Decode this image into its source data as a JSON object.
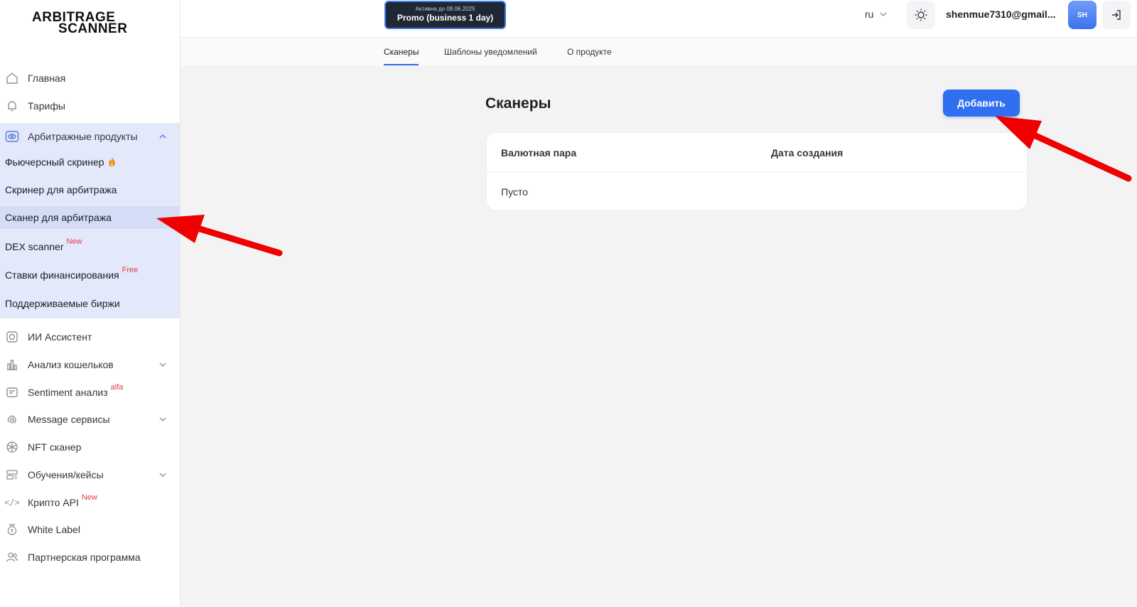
{
  "logo": {
    "line1": "ARBITRAGE",
    "line2": "SCANNER"
  },
  "header": {
    "promo_small": "Активна до 08.06.2025",
    "promo_big": "Promo (business 1 day)",
    "lang": "ru",
    "email": "shenmue7310@gmail...",
    "avatar": "SH"
  },
  "tabs": [
    "Сканеры",
    "Шаблоны уведомлений",
    "О продукте"
  ],
  "sidebar": {
    "items": [
      {
        "label": "Главная",
        "icon": "home-icon"
      },
      {
        "label": "Тарифы",
        "icon": "bell-icon"
      },
      {
        "label": "Арбитражные продукты",
        "icon": "eye-icon"
      },
      {
        "label": "ИИ Ассистент",
        "icon": "robot-icon"
      },
      {
        "label": "Анализ кошельков",
        "icon": "bar-chart-icon"
      },
      {
        "label": "Sentiment анализ",
        "tag": "alfa",
        "icon": "sentiment-icon"
      },
      {
        "label": "Message сервисы",
        "icon": "fingerprint-icon"
      },
      {
        "label": "NFT сканер",
        "icon": "nft-icon"
      },
      {
        "label": "Обучения/кейсы",
        "icon": "layout-icon"
      },
      {
        "label": "Крипто API",
        "tag": "New",
        "icon": "code-icon"
      },
      {
        "label": "White Label",
        "icon": "money-bag-icon"
      },
      {
        "label": "Партнерская программа",
        "icon": "users-icon"
      }
    ],
    "sub_items": [
      {
        "label": "Фьючерсный скринер",
        "icon": "fire-icon"
      },
      {
        "label": "Скринер для арбитража"
      },
      {
        "label": "Сканер для арбитража"
      },
      {
        "label": "DEX scanner",
        "tag": "New"
      },
      {
        "label": "Ставки финансирования",
        "tag": "Free"
      },
      {
        "label": "Поддерживаемые биржи"
      }
    ]
  },
  "main": {
    "title": "Сканеры",
    "add_button": "Добавить",
    "columns": [
      "Валютная пара",
      "Дата создания"
    ],
    "empty_text": "Пусто"
  },
  "colors": {
    "accent": "#2f6ff0",
    "annotation_arrow": "#f00000",
    "group_bg": "#e3e8fb"
  }
}
